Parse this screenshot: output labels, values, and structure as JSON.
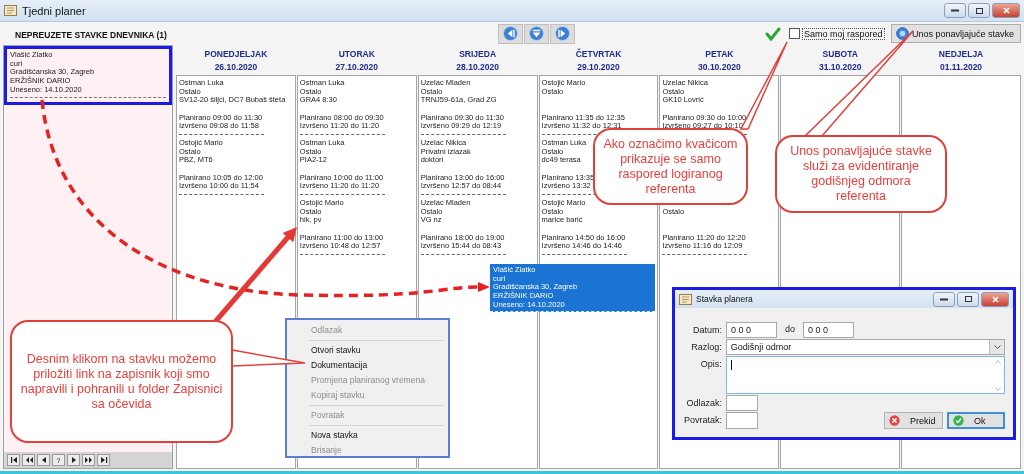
{
  "window": {
    "title": "Tjedni planer"
  },
  "unassigned": {
    "title": "NEPREUZETE STAVKE DNEVNIKA (1)",
    "items": [
      {
        "lines": [
          "Vlašić Zlatko",
          "curi",
          "Gradišćanska 30, Zagreb",
          "ERŽIŠNIK DARIO",
          "Uneseno: 14.10.2020"
        ],
        "selected": true
      }
    ],
    "pager_label": "?"
  },
  "only_mine": {
    "label": "Samo moj raspored",
    "checked": false
  },
  "recurring_button": {
    "label": "Unos ponavljajuće stavke"
  },
  "days": [
    {
      "name": "PONEDJELJAK",
      "date": "26.10.2020",
      "entries": [
        {
          "name": "Ostman Luka",
          "type": "Ostalo",
          "address": "SV12-20 šiljci, DC7 Bubaš šteta",
          "planned": "Planirano 09:00 do 11:30",
          "done": "Izvršeno 09:08 do 11:58"
        },
        {
          "name": "Ostojić Mario",
          "type": "Ostalo",
          "address": "PBZ, MT6",
          "planned": "Planirano 10:05 do 12:00",
          "done": "Izvršeno 10:00 do 11:54"
        }
      ]
    },
    {
      "name": "UTORAK",
      "date": "27.10.2020",
      "entries": [
        {
          "name": "Ostman Luka",
          "type": "Ostalo",
          "address": "GRA4 8:30",
          "planned": "Planirano 08:00 do 09:30",
          "done": "Izvršeno 11:20 do 11:20"
        },
        {
          "name": "Ostman Luka",
          "type": "Ostalo",
          "address": "PIA2-12",
          "planned": "Planirano 10:00 do 11:00",
          "done": "Izvršeno 11:20 do 11:20"
        },
        {
          "name": "Ostojić Mario",
          "type": "Ostalo",
          "address": "hik, pv",
          "planned": "Planirano 11:00 do 13:00",
          "done": "Izvršeno 10:48 do 12:57"
        }
      ]
    },
    {
      "name": "SRIJEDA",
      "date": "28.10.2020",
      "entries": [
        {
          "name": "Uzelac Mladen",
          "type": "Ostalo",
          "address": "TRNJ59-61a, Grad ZG",
          "planned": "Planirano 09:30 do 11:30",
          "done": "Izvršeno 09:29 do 12:19"
        },
        {
          "name": "Uzelac Nikica",
          "type": "Privatni izlazak",
          "address": "doktori",
          "planned": "Planirano 13:00 do 16:00",
          "done": "Izvršeno 12:57 do 08:44"
        },
        {
          "name": "Uzelac Mladen",
          "type": "Ostalo",
          "address": "VG nz",
          "planned": "Planirano 18:00 do 19:00",
          "done": "Izvršeno 15:44 do 08:43"
        }
      ]
    },
    {
      "name": "ČETVRTAK",
      "date": "29.10.2020",
      "entries": [
        {
          "name": "Ostojić Mario",
          "type": "Ostalo",
          "planned": "Planirano 11:35 do 12:35",
          "done": "Izvršeno 11:32 do 12:31"
        },
        {
          "name": "Ostman Luka",
          "type": "Ostalo",
          "address": "dc49 terasa",
          "planned": "Planirano 13:35",
          "done": "Izvršeno 13:32"
        },
        {
          "name": "Ostojić Mario",
          "type": "Ostalo",
          "address": "marice barić",
          "planned": "Planirano 14:50 do 16:00",
          "done": "Izvršeno 14:46 do 14:46"
        }
      ]
    },
    {
      "name": "PETAK",
      "date": "30.10.2020",
      "entries": [
        {
          "name": "Uzelac Nikica",
          "type": "Ostalo",
          "address": "GK10 Lovrić",
          "planned": "Planirano 09:30 do 10:00",
          "done": "Izvršeno 09:27 do 10:10"
        },
        {
          "type": "Ostalo",
          "planned": "Planirano 11:20 do 12:20",
          "done": "Izvršeno 11:16 do 12:09"
        }
      ]
    },
    {
      "name": "SUBOTA",
      "date": "31.10.2020"
    },
    {
      "name": "NEDJELJA",
      "date": "01.11.2020"
    }
  ],
  "dragged_item": {
    "lines": [
      "Vlašić Zlatko",
      "curi",
      "Gradišćanska 30, Zagreb",
      "ERŽIŠNIK DARIO",
      "Uneseno: 14.10.2020"
    ]
  },
  "context_menu": {
    "items": [
      {
        "kind": "item",
        "label": "Odlazak",
        "disabled": true
      },
      {
        "kind": "separator"
      },
      {
        "kind": "item",
        "label": "Otvori stavku",
        "disabled": false
      },
      {
        "kind": "item",
        "label": "Dokumentacija",
        "disabled": false
      },
      {
        "kind": "item",
        "label": "Promjena planiranog vremena",
        "disabled": true
      },
      {
        "kind": "item",
        "label": "Kopiraj stavku",
        "disabled": true
      },
      {
        "kind": "separator"
      },
      {
        "kind": "item",
        "label": "Povratak",
        "disabled": true
      },
      {
        "kind": "separator"
      },
      {
        "kind": "item",
        "label": "Nova stavka",
        "disabled": false
      },
      {
        "kind": "item",
        "label": "Brisanje",
        "disabled": true
      }
    ]
  },
  "dialog": {
    "title": "Stavka planera",
    "date_label": "Datum:",
    "date_from": "0 0 0",
    "to_label": "do",
    "date_to": "0 0 0",
    "reason_label": "Razlog:",
    "reason": "Godišnji odmor",
    "description_label": "Opis:",
    "description_focused": true,
    "departure_label": "Odlazak:",
    "return_label": "Povratak:",
    "buttons": [
      {
        "label": "Prekid",
        "kind": "cancel",
        "default": false
      },
      {
        "label": "Ok",
        "kind": "ok",
        "default": true
      }
    ]
  },
  "callouts": [
    {
      "text": "Ako označimo kvačicom prikazuje se samo raspored logiranog referenta"
    },
    {
      "text": "Unos ponavljajuće stavke služi za evidentiranje godišnjeg odmora referenta"
    },
    {
      "text": "Desnim klikom na stavku možemo priložiti link na zapisnik koji smo napravili i pohranili u folder Zapisnici sa očevida"
    }
  ]
}
